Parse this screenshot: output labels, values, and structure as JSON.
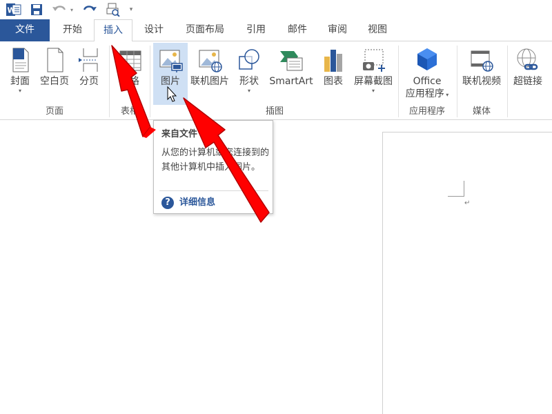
{
  "quick_access": {
    "app_icon": "word-icon",
    "save_icon": "save-icon",
    "undo_icon": "undo-icon",
    "redo_icon": "redo-icon",
    "print_icon": "print-preview-icon",
    "customize_icon": "chevron-down-icon"
  },
  "tabs": {
    "file": "文件",
    "home": "开始",
    "insert": "插入",
    "design": "设计",
    "layout": "页面布局",
    "references": "引用",
    "mailings": "邮件",
    "review": "审阅",
    "view": "视图"
  },
  "ribbon": {
    "pages": {
      "cover": "封面",
      "blank": "空白页",
      "break": "分页",
      "group": "页面"
    },
    "tables": {
      "table": "表格",
      "group": "表格"
    },
    "illustrations": {
      "pictures": "图片",
      "online_pictures": "联机图片",
      "shapes": "形状",
      "smartart": "SmartArt",
      "chart": "图表",
      "screenshot": "屏幕截图",
      "group": "插图"
    },
    "apps": {
      "office_line1": "Office",
      "office_line2": "应用程序",
      "group": "应用程序"
    },
    "media": {
      "online_video": "联机视频",
      "group": "媒体"
    },
    "links": {
      "hyperlink": "超链接"
    }
  },
  "tooltip": {
    "title": "来自文件",
    "body": "从您的计算机或您连接到的其他计算机中插入图片。",
    "help": "详细信息"
  },
  "colors": {
    "accent": "#2b579a",
    "hover": "#cfe0f4",
    "arrow": "#ff0000"
  }
}
